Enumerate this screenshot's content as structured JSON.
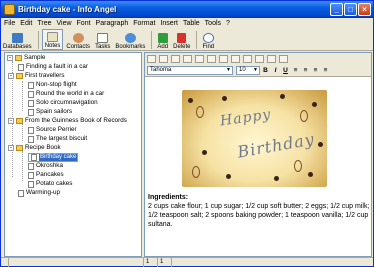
{
  "window": {
    "title": "Birthday cake - Info Angel",
    "min": "_",
    "max": "□",
    "close": "×"
  },
  "menu": [
    "File",
    "Edit",
    "Tree",
    "View",
    "Font",
    "Paragraph",
    "Format",
    "Insert",
    "Table",
    "Tools",
    "?"
  ],
  "toolbar": {
    "databases": "Databases",
    "notes": "Notes",
    "contacts": "Contacts",
    "tasks": "Tasks",
    "bookmarks": "Bookmarks",
    "add": "Add",
    "delete": "Delete",
    "find": "Find"
  },
  "tree": {
    "root": "Sample",
    "items": [
      "Finding a fault in a car",
      "First travellers",
      "Non-stop flight",
      "Round the world in a car",
      "Solo circumnavigation",
      "Spain sailors",
      "From the Guinness Book of Records",
      "Source Perrier",
      "The largest biscuit",
      "Recipe Book",
      "Birthday cake",
      "Okroshka",
      "Pancakes",
      "Potato cakes",
      "Warming-up"
    ]
  },
  "editor": {
    "font": "Tahoma",
    "size": "10",
    "bold": "B",
    "italic": "I",
    "underline": "U",
    "image_text": [
      "Happy",
      "Birthday"
    ],
    "heading": "Ingredients:",
    "body": "2 cups cake flour; 1 cup sugar; 1/2 cup soft butter; 2 eggs; 1/2 cup milk; 1/2 teaspoon salt; 2 spoons baking powder; 1 teaspoon vanilla; 1/2 cup sultana."
  },
  "status": [
    "1",
    "1"
  ],
  "colors": {
    "titlebar": "#0A5DDF",
    "selection": "#316AC5",
    "folder": "#F3CC5B"
  }
}
